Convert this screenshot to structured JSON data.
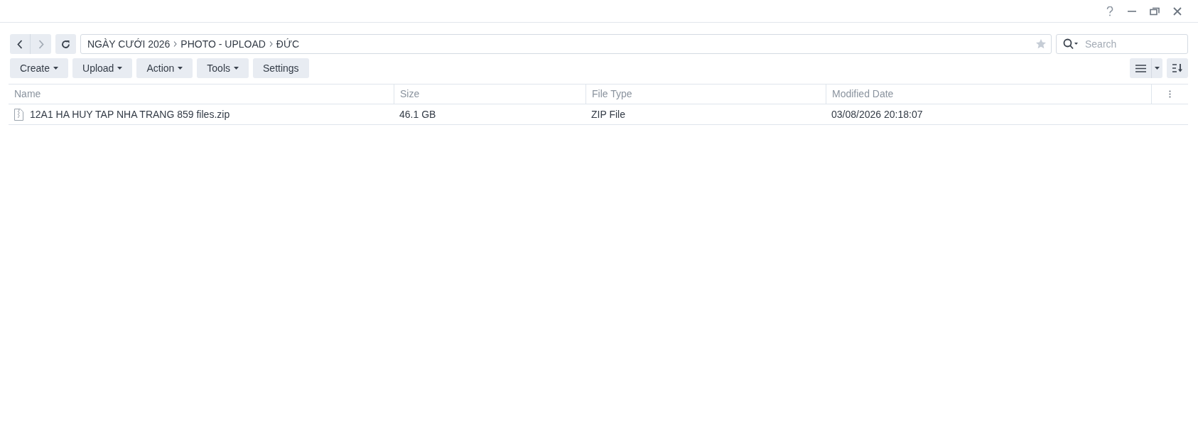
{
  "breadcrumb": [
    "NGÀY CƯỚI 2026",
    "PHOTO - UPLOAD",
    "ĐỨC"
  ],
  "search": {
    "placeholder": "Search"
  },
  "toolbar": [
    {
      "label": "Create",
      "dropdown": true
    },
    {
      "label": "Upload",
      "dropdown": true
    },
    {
      "label": "Action",
      "dropdown": true
    },
    {
      "label": "Tools",
      "dropdown": true
    },
    {
      "label": "Settings",
      "dropdown": false
    }
  ],
  "table": {
    "columns": [
      "Name",
      "Size",
      "File Type",
      "Modified Date"
    ],
    "rows": [
      {
        "cells": [
          "12A1 HA HUY TAP NHA TRANG 859 files.zip",
          "46.1 GB",
          "ZIP File",
          "03/08/2026 20:18:07"
        ]
      }
    ]
  }
}
